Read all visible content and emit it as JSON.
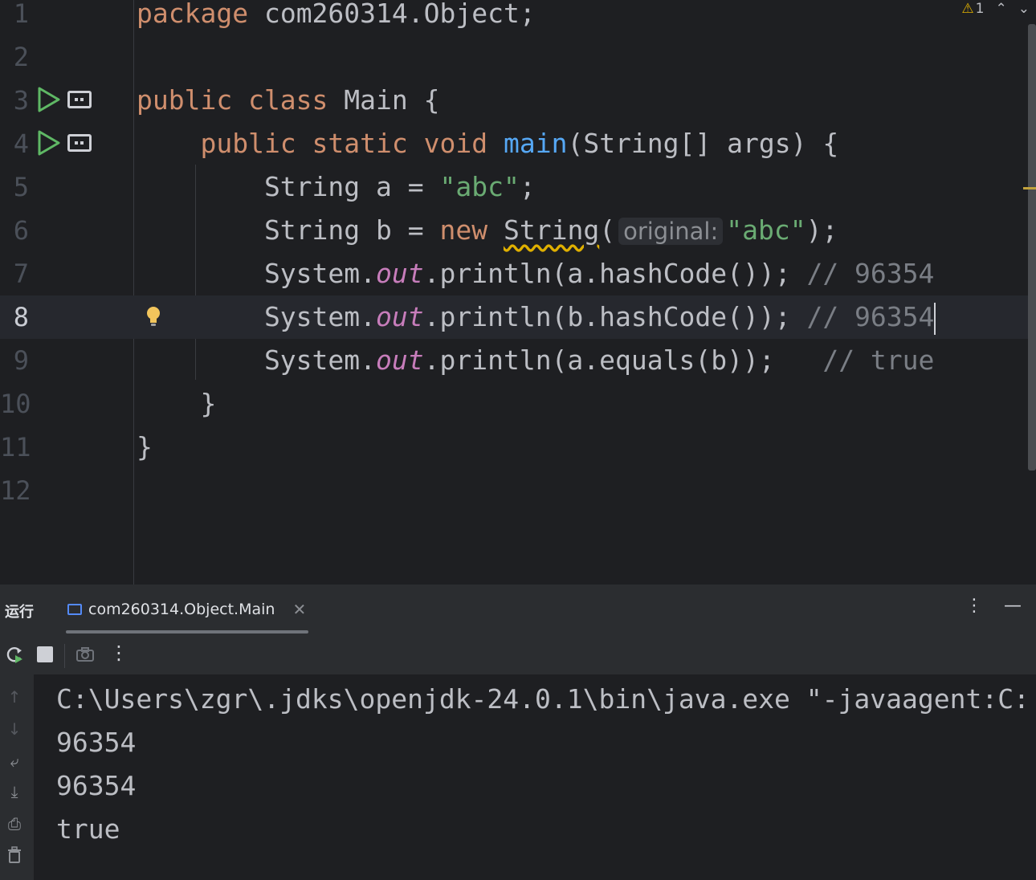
{
  "editor": {
    "lines": [
      {
        "num": "1",
        "segments": [
          {
            "t": "package ",
            "c": "kw"
          },
          {
            "t": "com260314.Object;",
            "c": ""
          }
        ]
      },
      {
        "num": "2",
        "segments": []
      },
      {
        "num": "3",
        "segments": [
          {
            "t": "public class ",
            "c": "kw"
          },
          {
            "t": "Main {",
            "c": ""
          }
        ]
      },
      {
        "num": "4",
        "segments": [
          {
            "t": "    public static void ",
            "c": "kw"
          },
          {
            "t": "main",
            "c": "fn"
          },
          {
            "t": "(String[] args) {",
            "c": ""
          }
        ]
      },
      {
        "num": "5",
        "segments": [
          {
            "t": "        String a = ",
            "c": ""
          },
          {
            "t": "\"abc\"",
            "c": "str"
          },
          {
            "t": ";",
            "c": ""
          }
        ]
      },
      {
        "num": "6",
        "segments": [
          {
            "t": "        String b = ",
            "c": ""
          },
          {
            "t": "new ",
            "c": "kw"
          },
          {
            "t": "String",
            "c": "warn"
          },
          {
            "t": "(",
            "c": ""
          },
          {
            "t": "original:",
            "c": "hint"
          },
          {
            "t": "\"abc\"",
            "c": "str"
          },
          {
            "t": ");",
            "c": ""
          }
        ]
      },
      {
        "num": "7",
        "segments": [
          {
            "t": "        System.",
            "c": ""
          },
          {
            "t": "out",
            "c": "fld"
          },
          {
            "t": ".println(a.hashCode()); ",
            "c": ""
          },
          {
            "t": "// 96354",
            "c": "cmt"
          }
        ]
      },
      {
        "num": "8",
        "current": true,
        "segments": [
          {
            "t": "        System.",
            "c": ""
          },
          {
            "t": "out",
            "c": "fld"
          },
          {
            "t": ".println(b.hashCode()); ",
            "c": ""
          },
          {
            "t": "// 96354",
            "c": "cmt"
          },
          {
            "t": "",
            "c": "caret"
          }
        ]
      },
      {
        "num": "9",
        "segments": [
          {
            "t": "        System.",
            "c": ""
          },
          {
            "t": "out",
            "c": "fld"
          },
          {
            "t": ".println(a.equals(b));   ",
            "c": ""
          },
          {
            "t": "// true",
            "c": "cmt"
          }
        ]
      },
      {
        "num": "10",
        "segments": [
          {
            "t": "    }",
            "c": ""
          }
        ]
      },
      {
        "num": "11",
        "segments": [
          {
            "t": "}",
            "c": ""
          }
        ]
      },
      {
        "num": "12",
        "segments": []
      }
    ],
    "inspections": {
      "warning_count": "1"
    }
  },
  "run_panel": {
    "title": "运行",
    "tab_label": "com260314.Object.Main",
    "output": [
      "C:\\Users\\zgr\\.jdks\\openjdk-24.0.1\\bin\\java.exe \"-javaagent:C:",
      "96354",
      "96354",
      "true"
    ]
  }
}
